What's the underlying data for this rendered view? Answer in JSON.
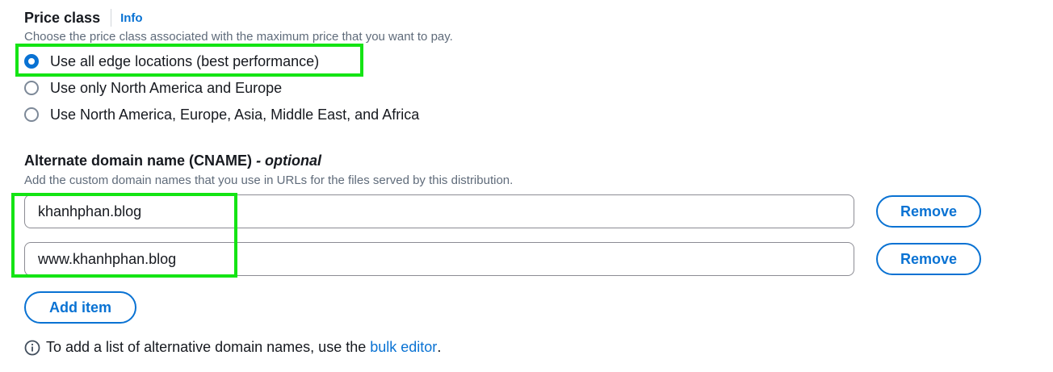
{
  "price_class": {
    "label": "Price class",
    "info_label": "Info",
    "description": "Choose the price class associated with the maximum price that you want to pay.",
    "options": [
      {
        "label": "Use all edge locations (best performance)",
        "checked": true
      },
      {
        "label": "Use only North America and Europe",
        "checked": false
      },
      {
        "label": "Use North America, Europe, Asia, Middle East, and Africa",
        "checked": false
      }
    ]
  },
  "cname": {
    "label": "Alternate domain name (CNAME)",
    "optional_label": "- optional",
    "description": "Add the custom domain names that you use in URLs for the files served by this distribution.",
    "items": [
      {
        "value": "khanhphan.blog",
        "remove_label": "Remove"
      },
      {
        "value": "www.khanhphan.blog",
        "remove_label": "Remove"
      }
    ],
    "add_item_label": "Add item",
    "hint_prefix": "To add a list of alternative domain names, use the",
    "hint_link": "bulk editor",
    "hint_suffix": "."
  },
  "colors": {
    "accent": "#0972d3",
    "highlight": "#14e414"
  }
}
